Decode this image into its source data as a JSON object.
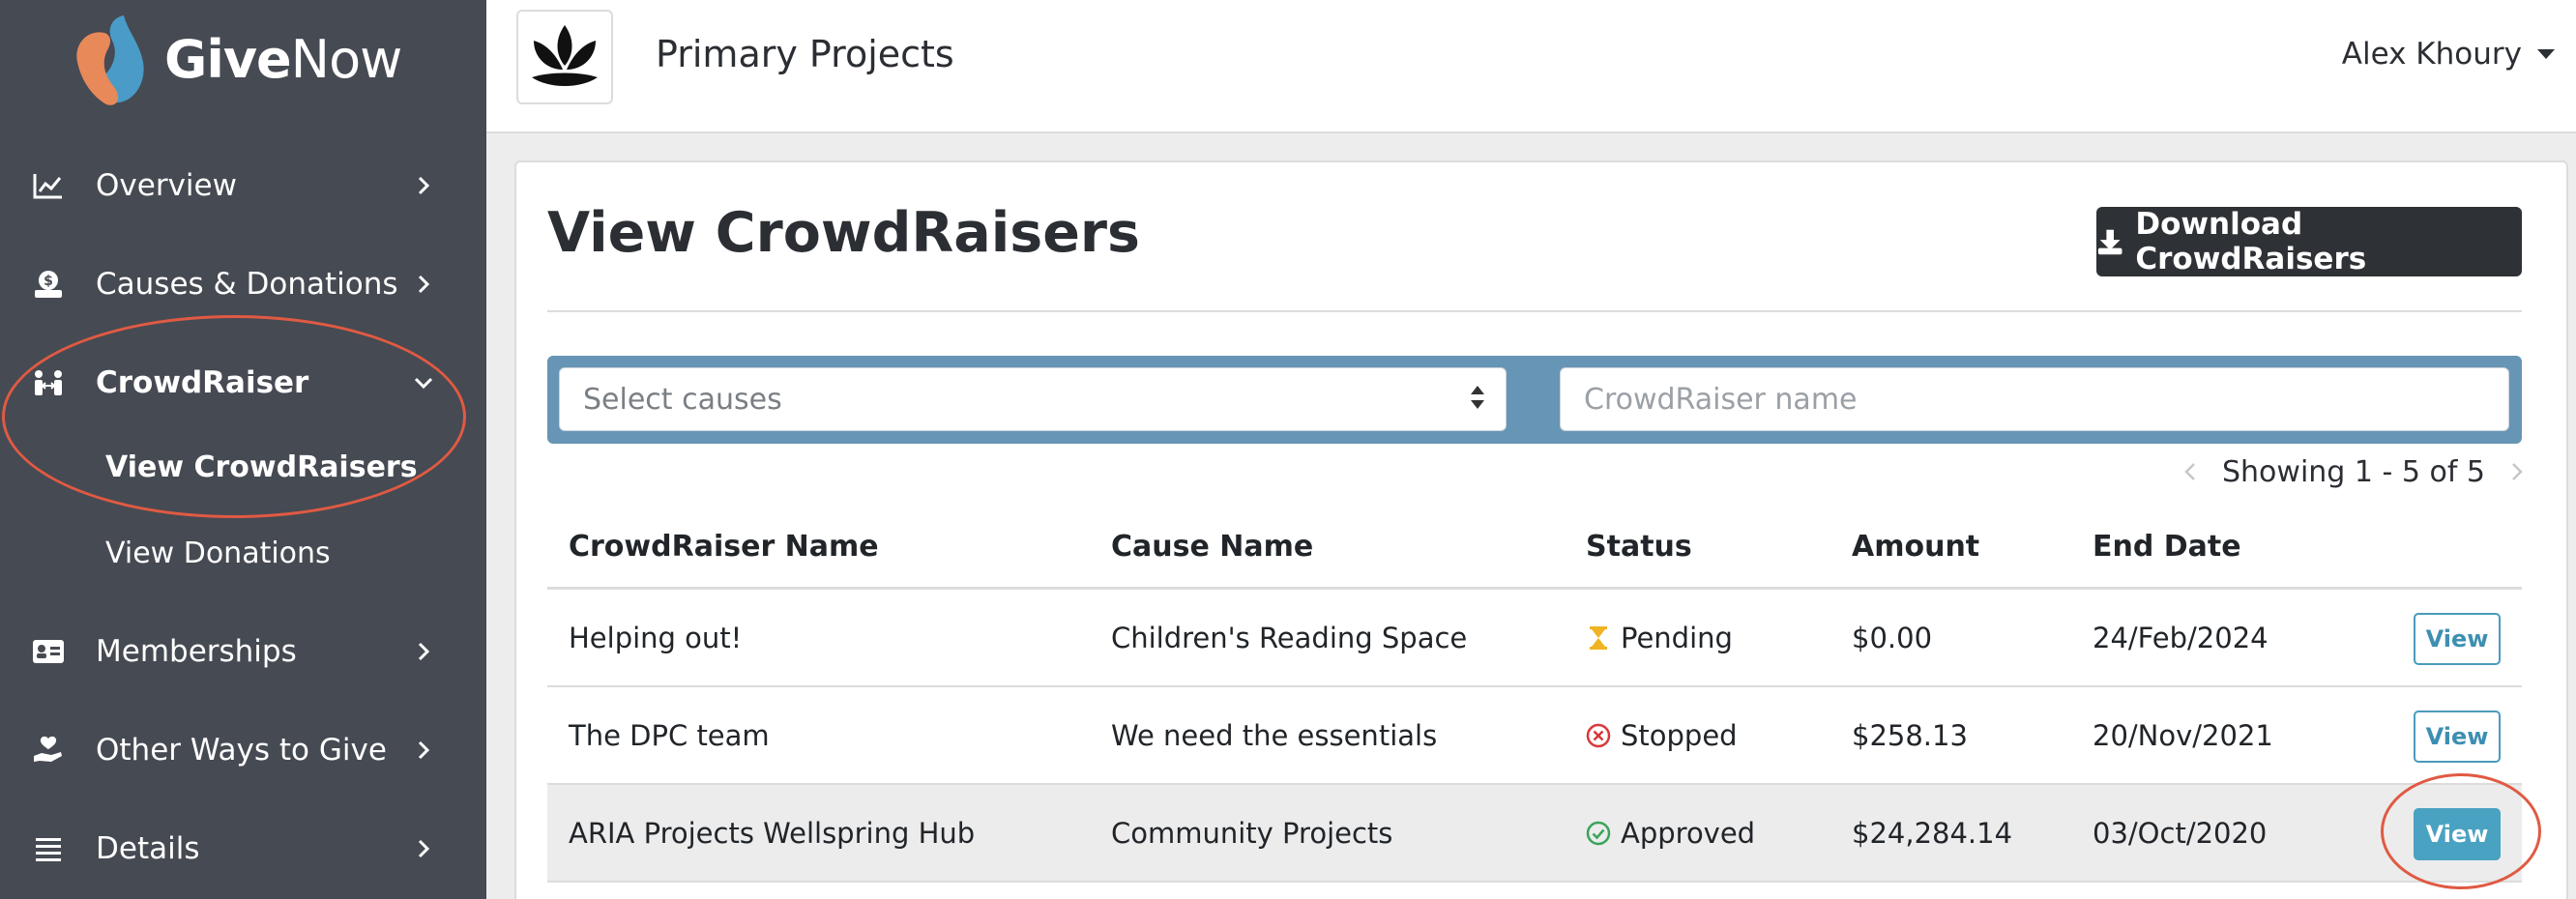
{
  "brand": {
    "give": "Give",
    "now": "Now"
  },
  "sidebar": {
    "items": [
      {
        "label": "Overview",
        "icon": "chart-line-icon"
      },
      {
        "label": "Causes & Donations",
        "icon": "donate-icon"
      },
      {
        "label": "CrowdRaiser",
        "icon": "people-arrows-icon",
        "expanded": true
      },
      {
        "label": "Memberships",
        "icon": "id-card-icon"
      },
      {
        "label": "Other Ways to Give",
        "icon": "hand-holding-heart-icon"
      },
      {
        "label": "Details",
        "icon": "list-icon"
      }
    ],
    "subitems": [
      {
        "label": "View CrowdRaisers",
        "active": true
      },
      {
        "label": "View Donations"
      }
    ]
  },
  "header": {
    "org_name": "Primary Projects",
    "user_name": "Alex Khoury"
  },
  "main": {
    "title": "View CrowdRaisers",
    "download_label": "Download CrowdRaisers",
    "filters": {
      "select_placeholder": "Select causes",
      "search_placeholder": "CrowdRaiser name"
    },
    "pagination": "Showing 1 - 5 of 5",
    "table": {
      "headers": [
        "CrowdRaiser Name",
        "Cause Name",
        "Status",
        "Amount",
        "End Date"
      ],
      "rows": [
        {
          "name": "Helping out!",
          "cause": "Children's Reading Space",
          "status": "Pending",
          "amount": "$0.00",
          "end_date": "24/Feb/2024",
          "action": "View"
        },
        {
          "name": "The DPC team",
          "cause": "We need the essentials",
          "status": "Stopped",
          "amount": "$258.13",
          "end_date": "20/Nov/2021",
          "action": "View"
        },
        {
          "name": "ARIA Projects Wellspring Hub",
          "cause": "Community Projects",
          "status": "Approved",
          "amount": "$24,284.14",
          "end_date": "03/Oct/2020",
          "action": "View"
        }
      ]
    }
  },
  "colors": {
    "sidebar_bg": "#464a52",
    "filter_bar": "#6795b5",
    "highlight": "#e05a43",
    "pending": "#f0b323",
    "stopped": "#d9383a",
    "approved": "#3aa35a",
    "view_accent": "#4aa2c2"
  }
}
